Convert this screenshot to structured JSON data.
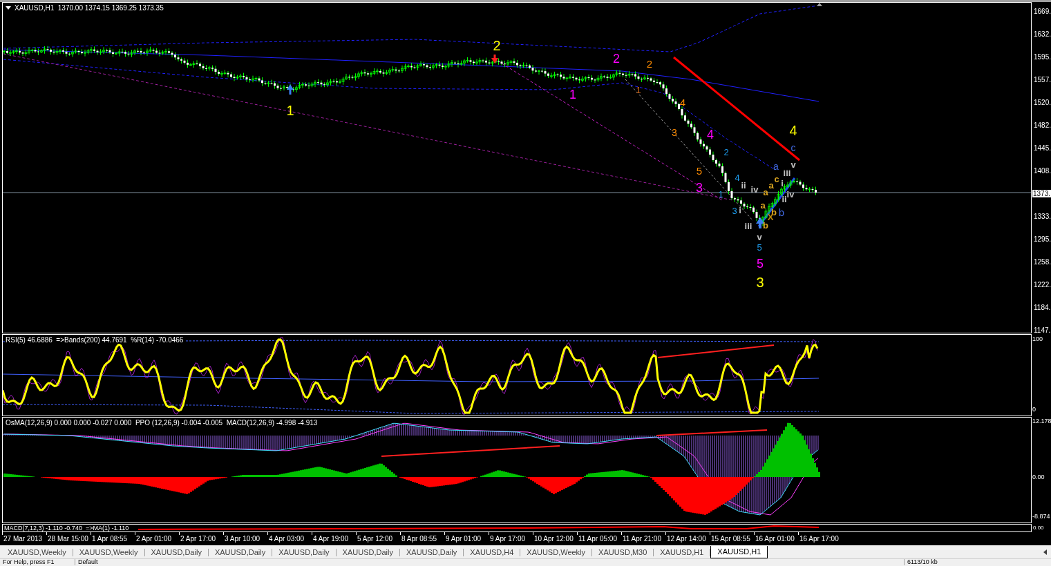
{
  "main_chart": {
    "header": "XAUUSD,H1  1370.00 1374.15 1369.25 1373.35",
    "price_axis": [
      {
        "text": "1669.",
        "highlighted": false
      },
      {
        "text": "1632.",
        "highlighted": false
      },
      {
        "text": "1595.",
        "highlighted": false
      },
      {
        "text": "1557.",
        "highlighted": false
      },
      {
        "text": "1520.",
        "highlighted": false
      },
      {
        "text": "1482.",
        "highlighted": false
      },
      {
        "text": "1445.",
        "highlighted": false
      },
      {
        "text": "1408.",
        "highlighted": false
      },
      {
        "text": "1373.",
        "highlighted": true
      },
      {
        "text": "1333.",
        "highlighted": false
      },
      {
        "text": "1295.",
        "highlighted": false
      },
      {
        "text": "1258.",
        "highlighted": false
      },
      {
        "text": "1222.",
        "highlighted": false
      },
      {
        "text": "1184.",
        "highlighted": false
      },
      {
        "text": "1147.",
        "highlighted": false
      }
    ],
    "wave_labels": [
      {
        "text": "1",
        "color": "#ffff00"
      },
      {
        "text": "2",
        "color": "#ffff00"
      },
      {
        "text": "3",
        "color": "#ffff00"
      },
      {
        "text": "4",
        "color": "#ffff00"
      },
      {
        "text": "1",
        "color": "#ff00ff"
      },
      {
        "text": "2",
        "color": "#ff00ff"
      },
      {
        "text": "3",
        "color": "#ff00ff"
      },
      {
        "text": "4",
        "color": "#ff00ff"
      },
      {
        "text": "5",
        "color": "#ff00ff"
      },
      {
        "text": "2",
        "color": "#ff8c00"
      },
      {
        "text": "1",
        "color": "#d2691e"
      },
      {
        "text": "4",
        "color": "#ff8c00"
      },
      {
        "text": "3",
        "color": "#ff8c00"
      },
      {
        "text": "5",
        "color": "#ff8c00"
      },
      {
        "text": "2",
        "color": "#1e9ef0"
      },
      {
        "text": "4",
        "color": "#1e9ef0"
      },
      {
        "text": "1",
        "color": "#1e9ef0"
      },
      {
        "text": "3",
        "color": "#1e9ef0"
      },
      {
        "text": "5",
        "color": "#1e9ef0"
      },
      {
        "text": "c",
        "color": "#4169e1"
      },
      {
        "text": "a",
        "color": "#4169e1"
      },
      {
        "text": "b",
        "color": "#4169e1"
      },
      {
        "text": "ii",
        "color": "#c0c0c0"
      },
      {
        "text": "iv",
        "color": "#c0c0c0"
      },
      {
        "text": "i",
        "color": "#c0c0c0"
      },
      {
        "text": "iii",
        "color": "#c0c0c0"
      },
      {
        "text": "v",
        "color": "#c0c0c0"
      },
      {
        "text": "v",
        "color": "#c0c0c0"
      },
      {
        "text": "iii",
        "color": "#c0c0c0"
      },
      {
        "text": "i",
        "color": "#c0c0c0"
      },
      {
        "text": "ii",
        "color": "#c0c0c0"
      },
      {
        "text": "iv",
        "color": "#c0c0c0"
      },
      {
        "text": "a",
        "color": "#daa520"
      },
      {
        "text": "c",
        "color": "#daa520"
      },
      {
        "text": "a",
        "color": "#daa520"
      },
      {
        "text": "a",
        "color": "#daa520"
      },
      {
        "text": "b",
        "color": "#daa520"
      },
      {
        "text": "X",
        "color": "#b8860b"
      },
      {
        "text": "b",
        "color": "#daa520"
      }
    ]
  },
  "rsi_panel": {
    "header": "RSI(5) 46.6886  =>Bands(200) 44.7691  %R(14) -70.0466",
    "axis": [
      "100",
      "0"
    ]
  },
  "macd_panel": {
    "header": "OsMA(12,26,9) 0.000 0.000 -0.027 0.000  PPO (12,26,9) -0.004 -0.005  MACD(12,26,9) -4.998 -4.913",
    "axis": [
      "12.178",
      "0.00",
      "-8.874"
    ]
  },
  "macd_small_panel": {
    "header": "MACD(7,12,3) -1.110 -0.740  =>MA(1) -1.110",
    "axis": [
      "0.00"
    ]
  },
  "time_axis": [
    "27 Mar 2013",
    "28 Mar 15:00",
    "1 Apr 08:55",
    "2 Apr 01:00",
    "2 Apr 17:00",
    "3 Apr 10:00",
    "4 Apr 03:00",
    "4 Apr 19:00",
    "5 Apr 12:00",
    "8 Apr 08:55",
    "9 Apr 01:00",
    "9 Apr 17:00",
    "10 Apr 12:00",
    "11 Apr 05:00",
    "11 Apr 21:00",
    "12 Apr 14:00",
    "15 Apr 08:55",
    "16 Apr 01:00",
    "16 Apr 17:00"
  ],
  "tabs": [
    {
      "label": "XAUUSD,Weekly",
      "selected": false
    },
    {
      "label": "XAUUSD,Weekly",
      "selected": false
    },
    {
      "label": "XAUUSD,Daily",
      "selected": false
    },
    {
      "label": "XAUUSD,Daily",
      "selected": false
    },
    {
      "label": "XAUUSD,Daily",
      "selected": false
    },
    {
      "label": "XAUUSD,Daily",
      "selected": false
    },
    {
      "label": "XAUUSD,Daily",
      "selected": false
    },
    {
      "label": "XAUUSD,H4",
      "selected": false
    },
    {
      "label": "XAUUSD,Weekly",
      "selected": false
    },
    {
      "label": "XAUUSD,M30",
      "selected": false
    },
    {
      "label": "XAUUSD,H1",
      "selected": false
    },
    {
      "label": "XAUUSD,H1",
      "selected": true
    }
  ],
  "status_bar": [
    "For Help, press F1",
    "Default",
    "6113/10 kb"
  ]
}
